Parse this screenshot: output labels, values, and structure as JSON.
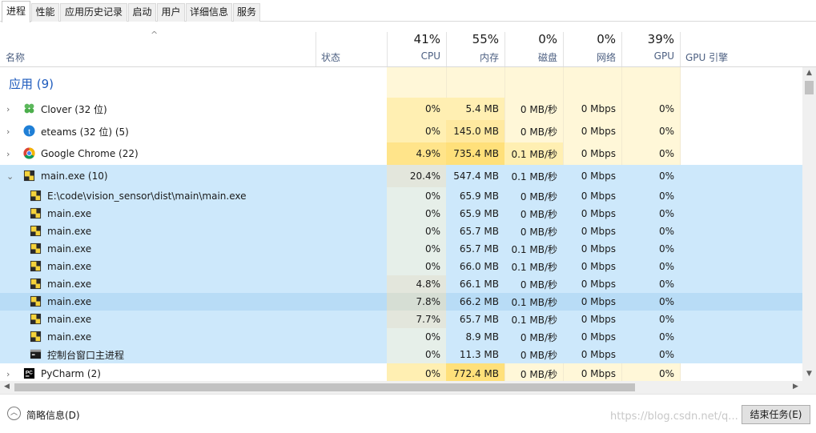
{
  "tabs": [
    "进程",
    "性能",
    "应用历史记录",
    "启动",
    "用户",
    "详细信息",
    "服务"
  ],
  "header": {
    "name_label": "名称",
    "status_label": "状态",
    "sort_icon": "^",
    "cpu": {
      "pct": "41%",
      "label": "CPU"
    },
    "mem": {
      "pct": "55%",
      "label": "内存"
    },
    "disk": {
      "pct": "0%",
      "label": "磁盘"
    },
    "net": {
      "pct": "0%",
      "label": "网络"
    },
    "gpu": {
      "pct": "39%",
      "label": "GPU"
    },
    "gpu_engine_label": "GPU 引擎"
  },
  "group_title": "应用 (9)",
  "rows": [
    {
      "name": "Clover (32 位)",
      "cpu": "0%",
      "mem": "5.4 MB",
      "disk": "0 MB/秒",
      "net": "0 Mbps",
      "gpu": "0%",
      "icon": "clover-icon"
    },
    {
      "name": "eteams (32 位) (5)",
      "cpu": "0%",
      "mem": "145.0 MB",
      "disk": "0 MB/秒",
      "net": "0 Mbps",
      "gpu": "0%",
      "icon": "eteams-icon"
    },
    {
      "name": "Google Chrome (22)",
      "cpu": "4.9%",
      "mem": "735.4 MB",
      "disk": "0.1 MB/秒",
      "net": "0 Mbps",
      "gpu": "0%",
      "icon": "chrome-icon"
    },
    {
      "name": "main.exe (10)",
      "cpu": "20.4%",
      "mem": "547.4 MB",
      "disk": "0.1 MB/秒",
      "net": "0 Mbps",
      "gpu": "0%",
      "icon": "python-exe-icon"
    }
  ],
  "children": [
    {
      "name": "E:\\code\\vision_sensor\\dist\\main\\main.exe",
      "cpu": "0%",
      "mem": "65.9 MB",
      "disk": "0 MB/秒",
      "net": "0 Mbps",
      "gpu": "0%"
    },
    {
      "name": "main.exe",
      "cpu": "0%",
      "mem": "65.9 MB",
      "disk": "0 MB/秒",
      "net": "0 Mbps",
      "gpu": "0%"
    },
    {
      "name": "main.exe",
      "cpu": "0%",
      "mem": "65.7 MB",
      "disk": "0 MB/秒",
      "net": "0 Mbps",
      "gpu": "0%"
    },
    {
      "name": "main.exe",
      "cpu": "0%",
      "mem": "65.7 MB",
      "disk": "0.1 MB/秒",
      "net": "0 Mbps",
      "gpu": "0%"
    },
    {
      "name": "main.exe",
      "cpu": "0%",
      "mem": "66.0 MB",
      "disk": "0.1 MB/秒",
      "net": "0 Mbps",
      "gpu": "0%"
    },
    {
      "name": "main.exe",
      "cpu": "4.8%",
      "mem": "66.1 MB",
      "disk": "0 MB/秒",
      "net": "0 Mbps",
      "gpu": "0%"
    },
    {
      "name": "main.exe",
      "cpu": "7.8%",
      "mem": "66.2 MB",
      "disk": "0.1 MB/秒",
      "net": "0 Mbps",
      "gpu": "0%"
    },
    {
      "name": "main.exe",
      "cpu": "7.7%",
      "mem": "65.7 MB",
      "disk": "0.1 MB/秒",
      "net": "0 Mbps",
      "gpu": "0%"
    },
    {
      "name": "main.exe",
      "cpu": "0%",
      "mem": "8.9 MB",
      "disk": "0 MB/秒",
      "net": "0 Mbps",
      "gpu": "0%"
    },
    {
      "name": "控制台窗口主进程",
      "cpu": "0%",
      "mem": "11.3 MB",
      "disk": "0 MB/秒",
      "net": "0 Mbps",
      "gpu": "0%",
      "icon": "console-icon"
    }
  ],
  "last_row": {
    "name": "PyCharm (2)",
    "cpu": "0%",
    "mem": "772.4 MB",
    "disk": "0 MB/秒",
    "net": "0 Mbps",
    "gpu": "0%",
    "icon": "pycharm-icon"
  },
  "footer": {
    "fewer_details": "简略信息(D)",
    "end_task": "结束任务(E)",
    "watermark": "https://blog.csdn.net/q..."
  },
  "colors": {
    "heat_light": "#fff7d8",
    "heat_mid": "#ffefb2",
    "heat_strong": "#ffe48a",
    "selected": "#cde8fb",
    "hover": "#b8dcf6",
    "group_blue": "#1e5bbd"
  }
}
